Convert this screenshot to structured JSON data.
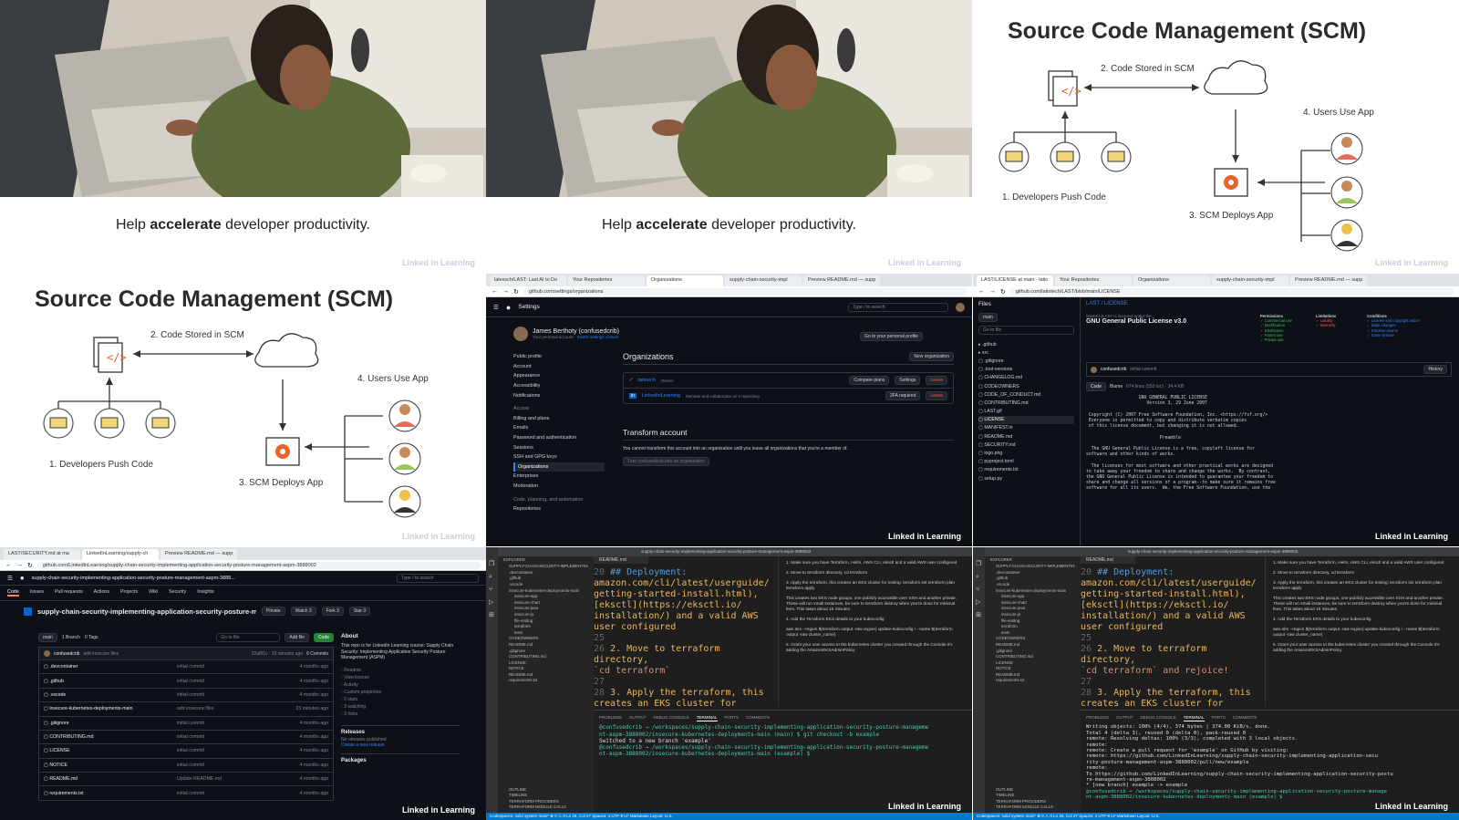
{
  "watermark": "Linked in Learning",
  "panel_caption": {
    "prefix": "Help ",
    "bold": "accelerate",
    "suffix": " developer productivity."
  },
  "scm": {
    "title": "Source Code Management (SCM)",
    "step1": "1. Developers Push Code",
    "step2": "2. Code Stored in SCM",
    "step3": "3. SCM Deploys App",
    "step4": "4. Users Use App"
  },
  "org_page": {
    "tabs": [
      "lalexsch/LAST: Last AI to Do",
      "Your Repositories",
      "Organizations",
      "supply-chain-security-impl",
      "Preview README.md — supp"
    ],
    "url": "github.com/settings/organizations",
    "header_title": "Settings",
    "search_placeholder": "Type / to search",
    "user_name": "James Berthoty (confusedcrib)",
    "user_sub": "Your personal account",
    "switch_account": "Switch settings context",
    "go_profile": "Go to your personal profile",
    "sidebar": [
      "Public profile",
      "Account",
      "Appearance",
      "Accessibility",
      "Notifications"
    ],
    "access_label": "Access",
    "sidebar_access": [
      "Billing and plans",
      "Emails",
      "Password and authentication",
      "Sessions",
      "SSH and GPG keys",
      "Organizations",
      "Enterprises",
      "Moderation"
    ],
    "code_label": "Code, planning, and automation",
    "sidebar_code": [
      "Repositories"
    ],
    "orgs_heading": "Organizations",
    "new_org": "New organization",
    "org1": {
      "name": "latioech",
      "role": "Owner",
      "compare": "Compare plans",
      "settings": "Settings",
      "leave": "Leave"
    },
    "org2": {
      "name": "LinkedInLearning",
      "role": "Member and collaborator on 1 repository",
      "twofa": "2FA required",
      "leave": "Leave"
    },
    "transform_heading": "Transform account",
    "transform_text": "You cannot transform this account into an organization until you leave all organizations that you're a member of.",
    "transform_btn": "Turn confusedcrib into an organization"
  },
  "license_page": {
    "tabs": [
      "LAST/LICENSE at main · latio",
      "Your Repositories",
      "Organizations",
      "supply-chain-security-impl",
      "Preview README.md — supp"
    ],
    "url": "github.com/latiotech/LAST/blob/main/LICENSE",
    "files_label": "Files",
    "branch": "main",
    "go_to_file": "Go to file",
    "breadcrumb": "LAST / LICENSE",
    "license_name": "GNU General Public License v3.0",
    "license_intro": "latiotech/LAST is licensed under the",
    "files": [
      ".github",
      "src",
      ".gitignore",
      ".tool-versions",
      "CHANGELOG.md",
      "CODEOWNERS",
      "CODE_OF_CONDUCT.md",
      "CONTRIBUTING.md",
      "LAST.gif",
      "LICENSE",
      "MANIFEST.in",
      "README.md",
      "SECURITY.md",
      "logo.png",
      "pyproject.toml",
      "requirements.txt",
      "setup.py"
    ],
    "perm_heads": [
      "Permissions",
      "Limitations",
      "Conditions"
    ],
    "perms": [
      "Commercial use",
      "Modification",
      "Distribution",
      "Patent use",
      "Private use"
    ],
    "limits": [
      "Liability",
      "Warranty"
    ],
    "conds": [
      "License and copyright notice",
      "State changes",
      "Disclose source",
      "Same license"
    ],
    "commit_user": "confusedcrib",
    "commit_msg": "initial commit",
    "history": "History",
    "code_tab": "Code",
    "blame_tab": "Blame",
    "file_meta": "674 lines (550 loc) · 34.4 KB",
    "license_text": "                    GNU GENERAL PUBLIC LICENSE\n                       Version 3, 29 June 2007\n\n Copyright (C) 2007 Free Software Foundation, Inc. <https://fsf.org/>\n Everyone is permitted to copy and distribute verbatim copies\n of this license document, but changing it is not allowed.\n\n                            Preamble\n\n  The GNU General Public License is a free, copyleft license for\nsoftware and other kinds of works.\n\n  The licenses for most software and other practical works are designed\nto take away your freedom to share and change the works.  By contrast,\nthe GNU General Public License is intended to guarantee your freedom to\nshare and change all versions of a program--to make sure it remains free\nsoftware for all its users.  We, the Free Software Foundation, use the"
  },
  "repo_page": {
    "tabs": [
      "LAST/SECURITY.md at ma",
      "LinkedInLearning/supply-ch",
      "Preview README.md — supp"
    ],
    "url": "github.com/LinkedInLearning/supply-chain-security-implementing-application-security-posture-management-aspm-3888002",
    "path": "supply-chain-security-implementing-application-security-posture-management-aspm-3888...",
    "nav": [
      "Code",
      "Issues",
      "Pull requests",
      "Actions",
      "Projects",
      "Wiki",
      "Security",
      "Insights"
    ],
    "repo_name": "supply-chain-security-implementing-application-security-posture-mana...",
    "visibility": "Private",
    "watch": "Watch 3",
    "fork": "Fork 3",
    "star": "Star 0",
    "branch": "main",
    "branches": "1 Branch",
    "tags": "0 Tags",
    "go_to_file": "Go to file",
    "add_file": "Add file",
    "code_btn": "Code",
    "commit_user": "confusedcrib",
    "commit_msg": "add insecure files",
    "commit_meta": "22af91c · 23 minutes ago",
    "commits": "6 Commits",
    "files": [
      {
        "name": ".devcontainer",
        "msg": "initial commit",
        "time": "4 months ago"
      },
      {
        "name": ".github",
        "msg": "initial commit",
        "time": "4 months ago"
      },
      {
        "name": ".vscode",
        "msg": "initial commit",
        "time": "4 months ago"
      },
      {
        "name": "insecure-kubernetes-deployments-main",
        "msg": "add insecure files",
        "time": "23 minutes ago"
      },
      {
        "name": ".gitignore",
        "msg": "initial commit",
        "time": "4 months ago"
      },
      {
        "name": "CONTRIBUTING.md",
        "msg": "initial commit",
        "time": "4 months ago"
      },
      {
        "name": "LICENSE",
        "msg": "initial commit",
        "time": "4 months ago"
      },
      {
        "name": "NOTICE",
        "msg": "initial commit",
        "time": "4 months ago"
      },
      {
        "name": "README.md",
        "msg": "Update README.md",
        "time": "4 months ago"
      },
      {
        "name": "requirements.txt",
        "msg": "initial commit",
        "time": "4 months ago"
      }
    ],
    "about_heading": "About",
    "about_text": "This repo is for LinkedIn Learning course: Supply Chain Security: Implementing Application Security Posture Management (ASPM)",
    "about_links": [
      "Readme",
      "View license",
      "Activity",
      "Custom properties",
      "0 stars",
      "3 watching",
      "3 forks"
    ],
    "releases": "Releases",
    "no_releases": "No releases published",
    "create_release": "Create a new release",
    "packages": "Packages"
  },
  "vscode_a": {
    "title": "supply-chain-security-implementing-application-security-posture-management-aspm-3888002",
    "explorer_head": "EXPLORER",
    "tree": [
      "SUPPLY-CHAIN-SECURITY-IMPLEMENTING-AP...",
      ".devcontainer",
      ".github",
      ".vscode",
      "insecure-kubernetes-deployments-main",
      "insecure-app",
      "insecure-chart",
      "insecure-java",
      "insecure-js",
      "file-ending",
      "terraform",
      "tests",
      "CODEOWNERS",
      "README.md",
      ".gitignore",
      "CONTRIBUTING.md",
      "LICENSE",
      "NOTICE",
      "README.md",
      "requirements.txt"
    ],
    "outline": [
      "OUTLINE",
      "TIMELINE",
      "TERRAFORM PROVIDERS",
      "TERRAFORM MODULE CALLS"
    ],
    "editor_tab": "README.md",
    "lines": [
      {
        "n": "20",
        "t": "## Deployment:"
      },
      {
        "n": "",
        "t": "amazon.com/cli/latest/userguide/"
      },
      {
        "n": "",
        "t": "getting-started-install.html),"
      },
      {
        "n": "",
        "t": "[eksctl](https://eksctl.io/"
      },
      {
        "n": "",
        "t": "installation/) and a valid AWS"
      },
      {
        "n": "",
        "t": "user configured"
      },
      {
        "n": "25",
        "t": ""
      },
      {
        "n": "26",
        "t": "2. Move to terraform directory,"
      },
      {
        "n": "",
        "t": "`cd terraform`"
      },
      {
        "n": "27",
        "t": ""
      },
      {
        "n": "28",
        "t": "3. Apply the terraform, this"
      },
      {
        "n": "",
        "t": "creates an EKS cluster for"
      }
    ],
    "preview": [
      "1. Make sure you have Terraform, Helm, AWS CLI, eksctl and a valid AWS user configured",
      "2. Move to terraform directory, cd terraform",
      "3. Apply the terraform, this creates an EKS cluster for testing: terraform init terraform plan terraform apply",
      "This creates two EKS node groups, one publicly accessible over SSH and another private. These will run small instances, be sure to terraform destroy when you're done for minimal fees. This takes about 15 minutes.",
      "4. Add the Terraform EKS details to your kubeconfig",
      "aws eks --region $(terraform output -raw region) update-kubeconfig \\ --name $(terraform output -raw cluster_name)",
      "5. Grant your user access to the kubernetes cluster you created through the Console it's adding the AmazonEKSAdminPolicy"
    ],
    "term_tabs": [
      "PROBLEMS",
      "OUTPUT",
      "DEBUG CONSOLE",
      "TERMINAL",
      "PORTS",
      "COMMENTS"
    ],
    "term": [
      {
        "c": "tg",
        "t": "@confusedcrib → /workspaces/supply-chain-security-implementing-application-security-posture-manageme"
      },
      {
        "c": "tg",
        "t": "nt-aspm-3888002/insecure-kubernetes-deployments-main (main) $ git checkout -b example"
      },
      {
        "c": "tw",
        "t": "Switched to a new branch 'example'"
      },
      {
        "c": "tg",
        "t": "@confusedcrib → /workspaces/supply-chain-security-implementing-application-security-posture-manageme"
      },
      {
        "c": "tg",
        "t": "nt-aspm-3888002/insecure-kubernetes-deployments-main (example) $"
      }
    ],
    "status": "Codespaces: solid system   main*   ⊗ 0 ⚠ 0   Ln 26, Col 27   Spaces: 4   UTF-8   LF   Markdown   Layout: U.S."
  },
  "vscode_b": {
    "lines": [
      {
        "n": "20",
        "t": "## Deployment:"
      },
      {
        "n": "",
        "t": "amazon.com/cli/latest/userguide/"
      },
      {
        "n": "",
        "t": "getting-started-install.html),"
      },
      {
        "n": "",
        "t": "[eksctl](https://eksctl.io/"
      },
      {
        "n": "",
        "t": "installation/) and a valid AWS"
      },
      {
        "n": "",
        "t": "user configured"
      },
      {
        "n": "25",
        "t": ""
      },
      {
        "n": "26",
        "t": "2. Move to terraform directory,"
      },
      {
        "n": "",
        "t": "`cd terraform` and rejoice!"
      },
      {
        "n": "27",
        "t": ""
      },
      {
        "n": "28",
        "t": "3. Apply the terraform, this"
      },
      {
        "n": "",
        "t": "creates an EKS cluster for"
      }
    ],
    "term": [
      {
        "c": "tw",
        "t": "Writing objects: 100% (4/4), 374 bytes | 374.00 KiB/s, done."
      },
      {
        "c": "tw",
        "t": "Total 4 (delta 3), reused 0 (delta 0), pack-reused 0"
      },
      {
        "c": "tw",
        "t": "remote: Resolving deltas: 100% (3/3), completed with 3 local objects."
      },
      {
        "c": "tw",
        "t": "remote:"
      },
      {
        "c": "tw",
        "t": "remote: Create a pull request for 'example' on GitHub by visiting:"
      },
      {
        "c": "tw",
        "t": "remote:      https://github.com/LinkedInLearning/supply-chain-security-implementing-application-secu"
      },
      {
        "c": "tw",
        "t": "rity-posture-management-aspm-3888002/pull/new/example"
      },
      {
        "c": "tw",
        "t": "remote:"
      },
      {
        "c": "tw",
        "t": "To https://github.com/LinkedInLearning/supply-chain-security-implementing-application-security-postu"
      },
      {
        "c": "tw",
        "t": "re-management-aspm-3888002"
      },
      {
        "c": "tw",
        "t": " * [new branch]      example -> example"
      },
      {
        "c": "tg",
        "t": "@confusedcrib → /workspaces/supply-chain-security-implementing-application-security-posture-manage"
      },
      {
        "c": "tg",
        "t": "nt-aspm-3888002/insecure-kubernetes-deployments-main (example) $"
      }
    ]
  },
  "colors": {
    "gh_bg": "#0d1117",
    "vs_bg": "#1e1e1e",
    "vs_status": "#007acc",
    "accent_green": "#238636",
    "gear_orange": "#e8632b"
  }
}
